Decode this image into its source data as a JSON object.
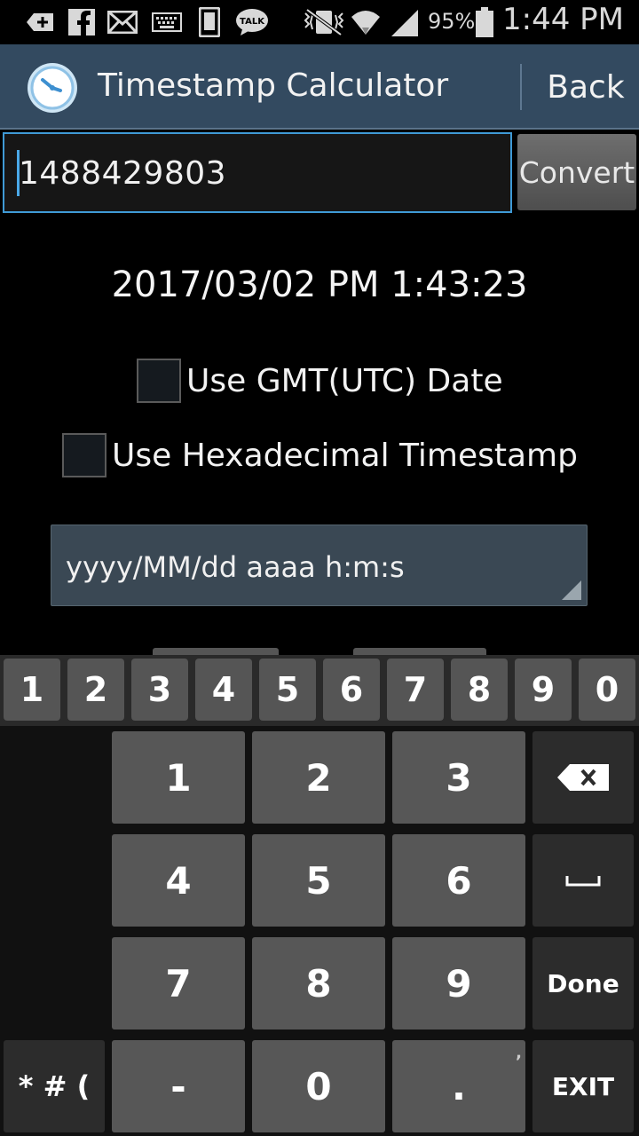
{
  "status_bar": {
    "battery_percent": "95%",
    "time": "1:44 PM",
    "icons": [
      "plus-icon",
      "facebook-icon",
      "mail-icon",
      "keyboard-icon",
      "phone-icon",
      "talk-icon",
      "vibrate-icon",
      "wifi-icon",
      "signal-icon",
      "battery-icon"
    ],
    "talk_label": "TALK"
  },
  "action_bar": {
    "title": "Timestamp Calculator",
    "back_label": "Back"
  },
  "input": {
    "value": "1488429803"
  },
  "convert_label": "Convert",
  "result": "2017/03/02 PM 1:43:23",
  "options": {
    "gmt_label": "Use GMT(UTC) Date",
    "gmt_checked": false,
    "hex_label": "Use Hexadecimal Timestamp",
    "hex_checked": false
  },
  "format": {
    "selected": "yyyy/MM/dd aaaa h:m:s"
  },
  "keyboard": {
    "number_row": [
      "1",
      "2",
      "3",
      "4",
      "5",
      "6",
      "7",
      "8",
      "9",
      "0"
    ],
    "pad": [
      "1",
      "2",
      "3",
      "4",
      "5",
      "6",
      "7",
      "8",
      "9",
      "-",
      "0",
      "."
    ],
    "done_label": "Done",
    "exit_label": "EXIT",
    "symbols_label": "* # (",
    "dot_hint": ","
  },
  "colors": {
    "action_bar": "#334a60",
    "input_focus": "#3f9ad6"
  }
}
